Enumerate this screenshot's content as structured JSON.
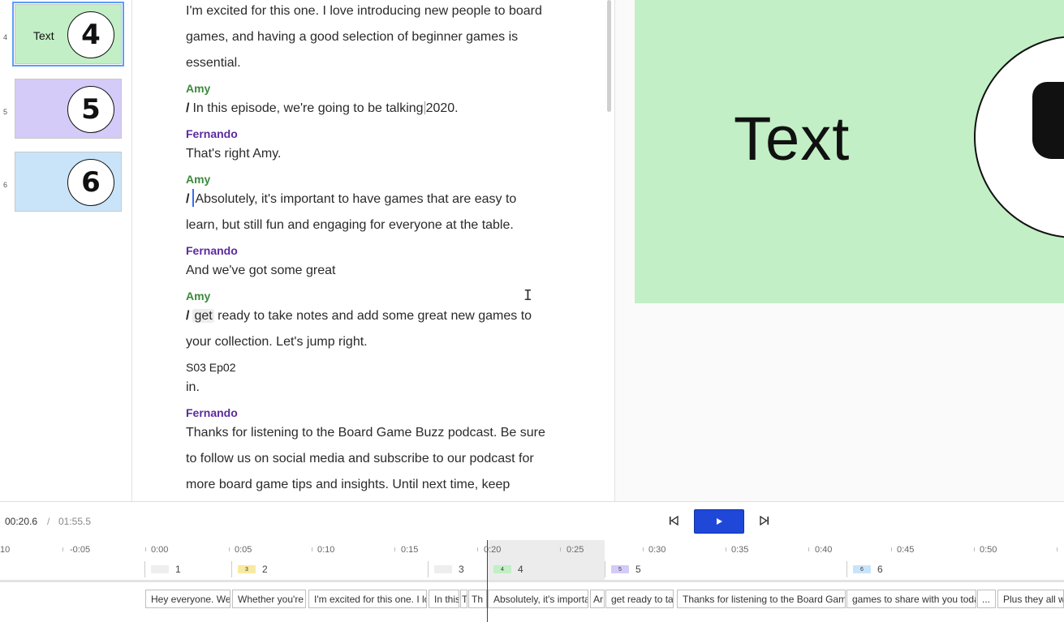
{
  "sidebar": {
    "scenes": [
      {
        "number": "4",
        "label": "Text",
        "badge": "4",
        "color": "#c2efc5",
        "selected": true
      },
      {
        "number": "5",
        "label": "",
        "badge": "5",
        "color": "#d4cbf8",
        "selected": false
      },
      {
        "number": "6",
        "label": "",
        "badge": "6",
        "color": "#c9e4f9",
        "selected": false
      }
    ]
  },
  "transcript": {
    "p1_line1": "I'm excited for this one. I love introducing new people to board",
    "p1_line2": "games, and having a good selection of beginner games is",
    "p1_line3": "essential.",
    "s1": "Amy",
    "p2_a": "In this episode, we're going to be talking",
    "p2_b": "2020.",
    "s2": "Fernando",
    "p3": "That's right Amy.",
    "s3": "Amy",
    "p4_line1": "Absolutely, it's important to have games that are easy to",
    "p4_line2": "learn, but still fun and engaging for everyone at the table.",
    "s4": "Fernando",
    "p5": "And we've got some great",
    "s5": "Amy",
    "p6_hl": "get",
    "p6_line1_rest": " ready to take notes and add some great new games to",
    "p6_line2": "your collection. Let's jump right.",
    "scene_label": "S03 Ep02",
    "p7": "in.",
    "s6": "Fernando",
    "p8_line1": "Thanks for listening to the Board Game Buzz podcast. Be sure",
    "p8_line2": "to follow us on social media and subscribe to our podcast for",
    "p8_line3": "more board game tips and insights. Until next time, keep",
    "slash": "/"
  },
  "preview": {
    "canvas_text": "Text",
    "canvas_color": "#c2efc5"
  },
  "controls": {
    "current_time": "00:20.6",
    "separator": "/",
    "total_time": "01:55.5",
    "prev_icon": "skip-back-icon",
    "play_icon": "play-icon",
    "next_icon": "skip-forward-icon"
  },
  "timeline": {
    "ruler": [
      "10",
      "-0:05",
      "0:00",
      "0:05",
      "0:10",
      "0:15",
      "0:20",
      "0:25",
      "0:30",
      "0:35",
      "0:40",
      "0:45",
      "0:50"
    ],
    "scene_markers": [
      "1",
      "2",
      "3",
      "4",
      "5",
      "6"
    ],
    "chip_labels": {
      "2": "3",
      "4": "4",
      "5": "5",
      "6": "6"
    },
    "clips": [
      "Hey everyone. Wel",
      "Whether you're",
      "I'm excited for this one. I lo",
      "In this",
      "T",
      "Th",
      "Absolutely, it's importa",
      "Ar",
      "get ready to ta",
      "Thanks for listening to the Board Gam",
      "games to share with you toda",
      "...",
      "Plus they all w"
    ]
  }
}
